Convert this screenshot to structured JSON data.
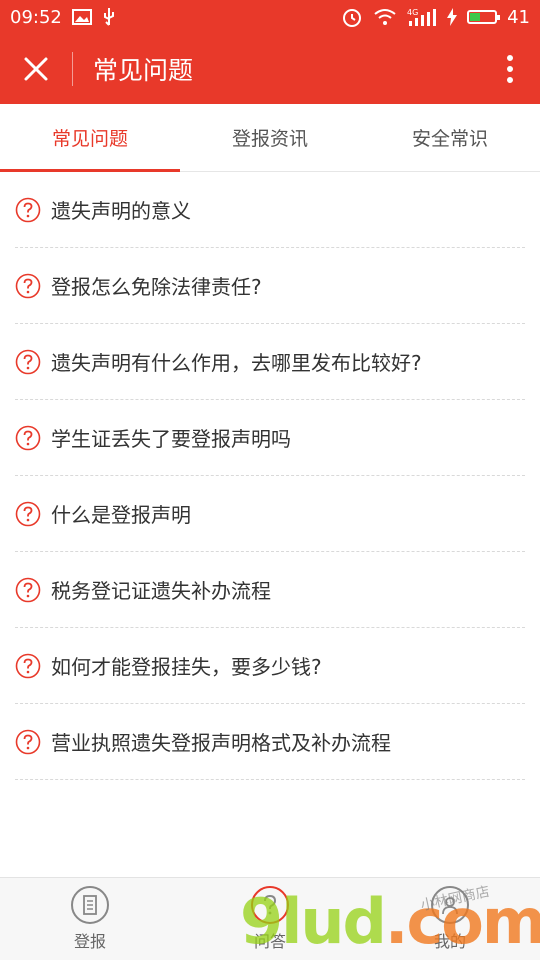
{
  "status_bar": {
    "time": "09:52",
    "battery_level": "41",
    "network": "4G"
  },
  "app_bar": {
    "title": "常见问题"
  },
  "tabs": [
    {
      "label": "常见问题",
      "active": true
    },
    {
      "label": "登报资讯",
      "active": false
    },
    {
      "label": "安全常识",
      "active": false
    }
  ],
  "faq": [
    {
      "text": "遗失声明的意义"
    },
    {
      "text": "登报怎么免除法律责任?"
    },
    {
      "text": "遗失声明有什么作用，去哪里发布比较好?"
    },
    {
      "text": "学生证丢失了要登报声明吗"
    },
    {
      "text": "什么是登报声明"
    },
    {
      "text": "税务登记证遗失补办流程"
    },
    {
      "text": "如何才能登报挂失，要多少钱?"
    },
    {
      "text": "营业执照遗失登报声明格式及补办流程"
    }
  ],
  "bottom_nav": [
    {
      "label": "登报",
      "icon": "document-icon"
    },
    {
      "label": "问答",
      "icon": "question-icon"
    },
    {
      "label": "我的",
      "icon": "user-icon"
    }
  ],
  "watermark": {
    "text": "9lud",
    "suffix": ".com",
    "small_text": "小林网商店"
  },
  "colors": {
    "primary": "#e8392a",
    "text": "#333333",
    "divider": "#d9d9d9"
  }
}
